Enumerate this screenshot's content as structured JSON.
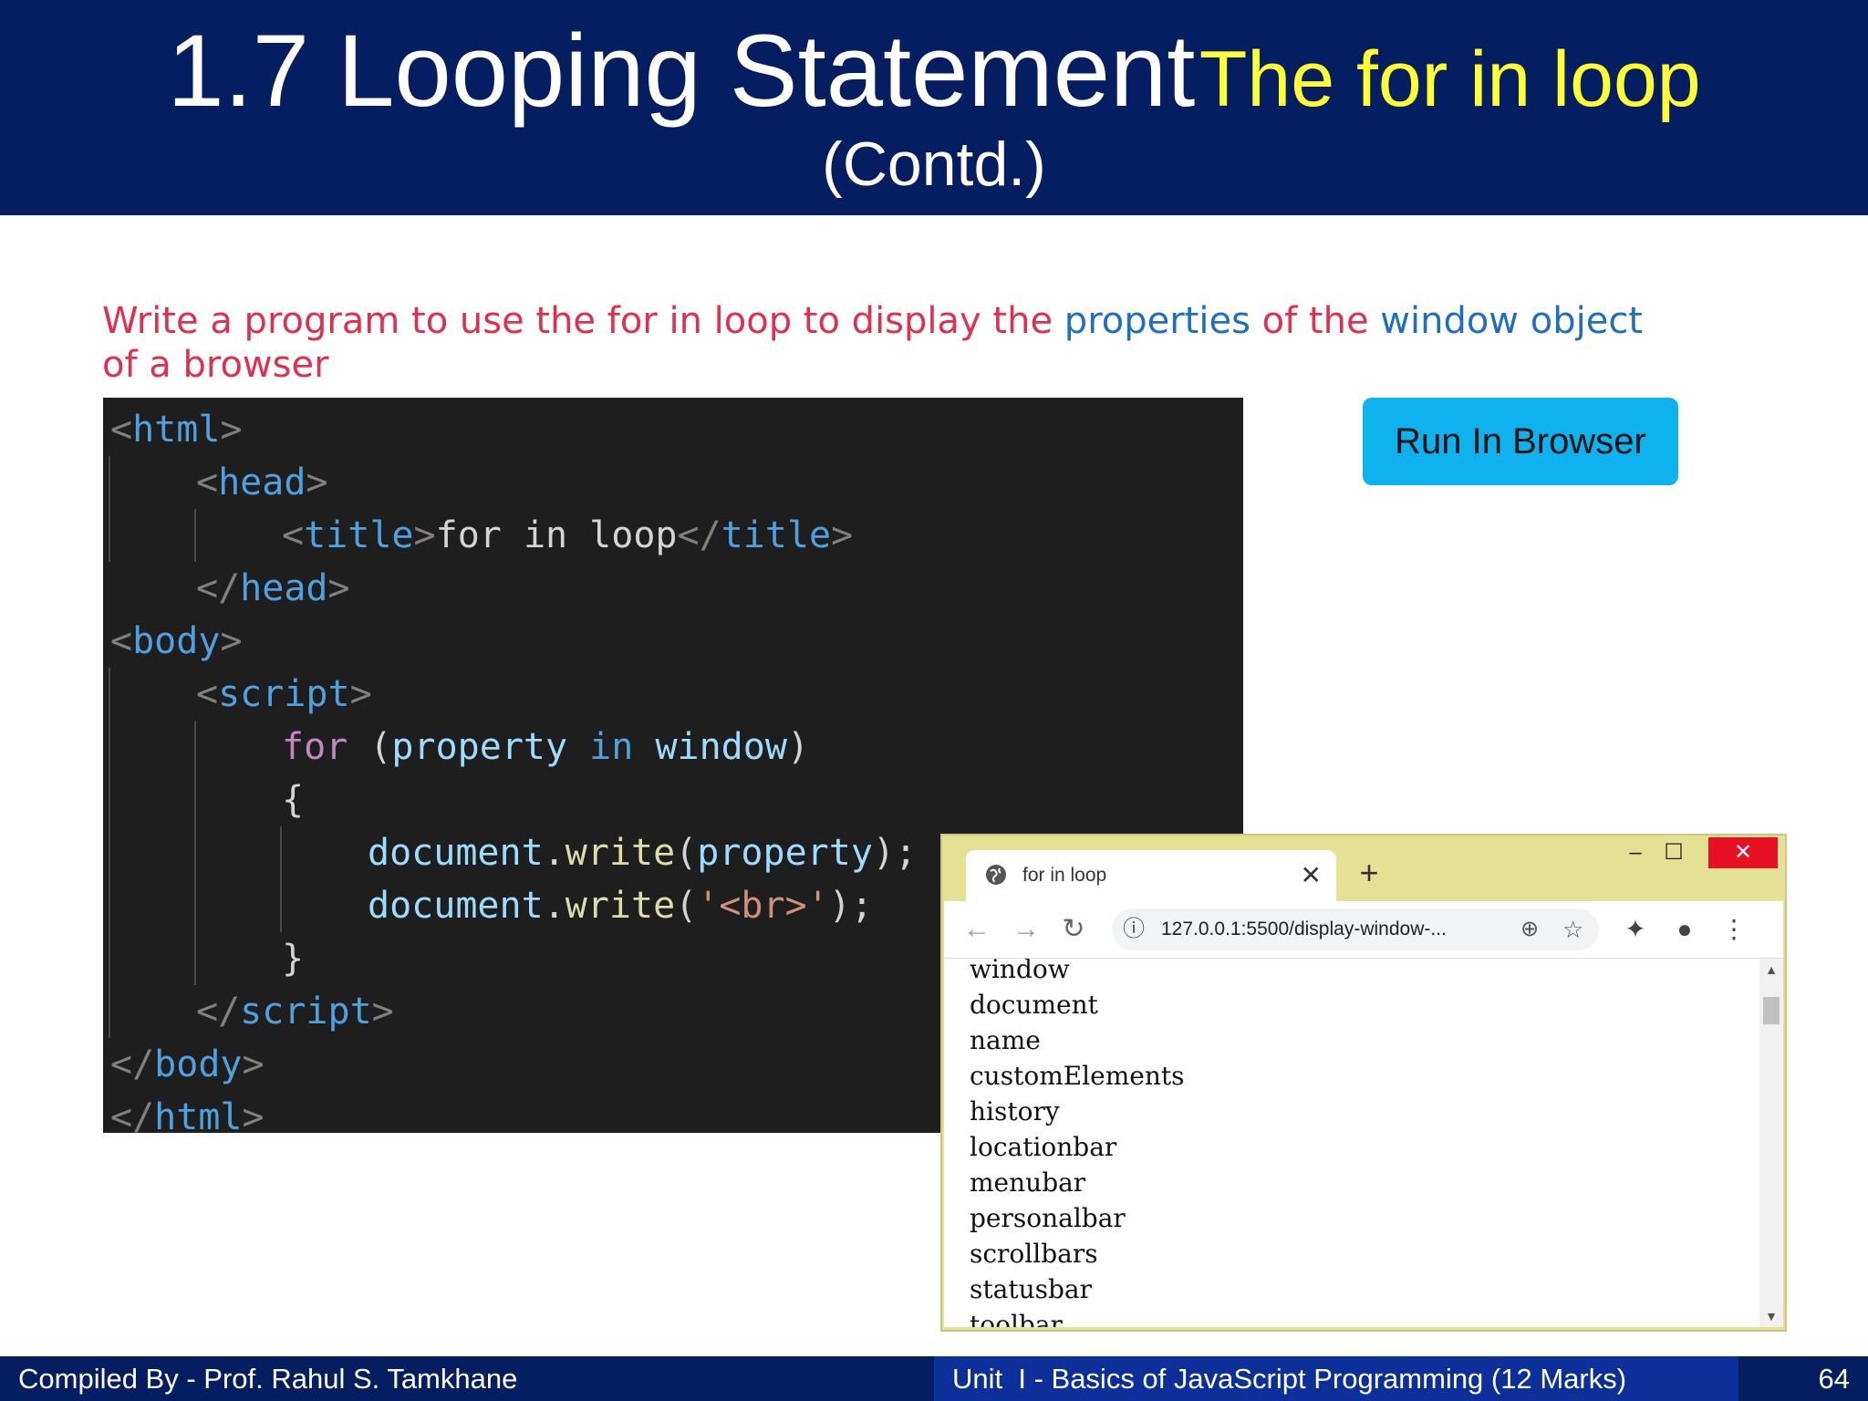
{
  "header": {
    "title_main": "1.7 Looping Statement",
    "title_sub": "The for in loop",
    "title_contd": "(Contd.)"
  },
  "question": {
    "part1": "Write a program to use the for in loop to display the ",
    "hl1": "properties",
    "part2": " of the ",
    "hl2": "window object",
    "part3": " of a browser"
  },
  "code": {
    "l1_open": "<",
    "l1_tag": "html",
    "l1_close": ">",
    "l2_open": "<",
    "l2_tag": "head",
    "l2_close": ">",
    "l3_open": "<",
    "l3_tag": "title",
    "l3_close": ">",
    "l3_text": "for in loop",
    "l3_open2": "</",
    "l3_tag2": "title",
    "l3_close2": ">",
    "l4_open": "</",
    "l4_tag": "head",
    "l4_close": ">",
    "l5_open": "<",
    "l5_tag": "body",
    "l5_close": ">",
    "l6_open": "<",
    "l6_tag": "script",
    "l6_close": ">",
    "l7_kw": "for",
    "l7_p1": " (",
    "l7_v1": "property",
    "l7_sp1": " ",
    "l7_kw2": "in",
    "l7_sp2": " ",
    "l7_v2": "window",
    "l7_p2": ")",
    "l8": "{",
    "l9_v": "document",
    "l9_dot": ".",
    "l9_f": "write",
    "l9_p1": "(",
    "l9_arg": "property",
    "l9_p2": ");",
    "l10_v": "document",
    "l10_dot": ".",
    "l10_f": "write",
    "l10_p1": "(",
    "l10_s": "'<br>'",
    "l10_p2": ");",
    "l11": "}",
    "l12_open": "</",
    "l12_tag": "script",
    "l12_close": ">",
    "l13_open": "</",
    "l13_tag": "body",
    "l13_close": ">",
    "l14_open": "</",
    "l14_tag": "html",
    "l14_close": ">"
  },
  "run_button": {
    "label": "Run In Browser"
  },
  "browser": {
    "tab_title": "for in loop",
    "tab_close": "✕",
    "new_tab": "+",
    "win_min": "–",
    "win_max": "☐",
    "win_close": "✕",
    "back": "←",
    "forward": "→",
    "reload": "↻",
    "address": "127.0.0.1:5500/display-window-...",
    "info_icon": "ⓘ",
    "zoom_icon": "⊕",
    "star_icon": "☆",
    "ext_icon": "✦",
    "profile_icon": "●",
    "menu_icon": "⋮",
    "properties": [
      "window",
      "document",
      "name",
      "customElements",
      "history",
      "locationbar",
      "menubar",
      "personalbar",
      "scrollbars",
      "statusbar",
      "toolbar"
    ],
    "sb_up": "▲",
    "sb_down": "▼"
  },
  "footer": {
    "left": "Compiled By - Prof. Rahul S. Tamkhane",
    "middle": "Unit  I - Basics of JavaScript Programming (12 Marks)",
    "page": "64"
  },
  "colors": {
    "header_bg": "#051e61",
    "title_accent": "#ffff33",
    "question_text": "#e0304f",
    "question_highlight": "#1f6fc0",
    "button_bg": "#0db2ef",
    "browser_frame": "#e4e195"
  }
}
